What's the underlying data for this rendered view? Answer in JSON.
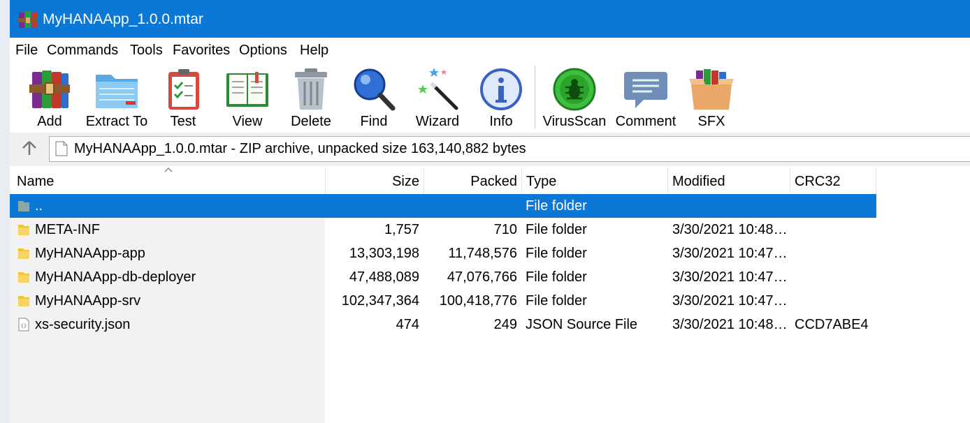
{
  "window": {
    "title": "MyHANAApp_1.0.0.mtar"
  },
  "menu": [
    "File",
    "Commands",
    "Tools",
    "Favorites",
    "Options",
    "Help"
  ],
  "toolbar": [
    {
      "label": "Add",
      "icon": "add-archive-icon"
    },
    {
      "label": "Extract To",
      "icon": "extract-folder-icon"
    },
    {
      "label": "Test",
      "icon": "test-clipboard-icon"
    },
    {
      "label": "View",
      "icon": "view-book-icon"
    },
    {
      "label": "Delete",
      "icon": "trash-can-icon"
    },
    {
      "label": "Find",
      "icon": "magnifier-icon"
    },
    {
      "label": "Wizard",
      "icon": "magic-wand-icon"
    },
    {
      "label": "Info",
      "icon": "info-icon"
    },
    {
      "label": "VirusScan",
      "icon": "virus-bug-icon"
    },
    {
      "label": "Comment",
      "icon": "comment-bubble-icon"
    },
    {
      "label": "SFX",
      "icon": "sfx-box-icon"
    }
  ],
  "address": {
    "path": "MyHANAApp_1.0.0.mtar - ZIP archive, unpacked size 163,140,882 bytes"
  },
  "columns": {
    "name": "Name",
    "size": "Size",
    "packed": "Packed",
    "type": "Type",
    "modified": "Modified",
    "crc": "CRC32"
  },
  "rows": [
    {
      "name": "..",
      "size": "",
      "packed": "",
      "type": "File folder",
      "modified": "",
      "crc": "",
      "icon": "parent-folder-icon",
      "selected": true
    },
    {
      "name": "META-INF",
      "size": "1,757",
      "packed": "710",
      "type": "File folder",
      "modified": "3/30/2021 10:48…",
      "crc": "",
      "icon": "folder-icon"
    },
    {
      "name": "MyHANAApp-app",
      "size": "13,303,198",
      "packed": "11,748,576",
      "type": "File folder",
      "modified": "3/30/2021 10:47…",
      "crc": "",
      "icon": "folder-icon"
    },
    {
      "name": "MyHANAApp-db-deployer",
      "size": "47,488,089",
      "packed": "47,076,766",
      "type": "File folder",
      "modified": "3/30/2021 10:47…",
      "crc": "",
      "icon": "folder-icon"
    },
    {
      "name": "MyHANAApp-srv",
      "size": "102,347,364",
      "packed": "100,418,776",
      "type": "File folder",
      "modified": "3/30/2021 10:47…",
      "crc": "",
      "icon": "folder-icon"
    },
    {
      "name": "xs-security.json",
      "size": "474",
      "packed": "249",
      "type": "JSON Source File",
      "modified": "3/30/2021 10:48…",
      "crc": "CCD7ABE4",
      "icon": "json-file-icon"
    }
  ],
  "colors": {
    "accent": "#0b78d7",
    "selection": "#0b78d7",
    "folder": "#f4c430"
  }
}
